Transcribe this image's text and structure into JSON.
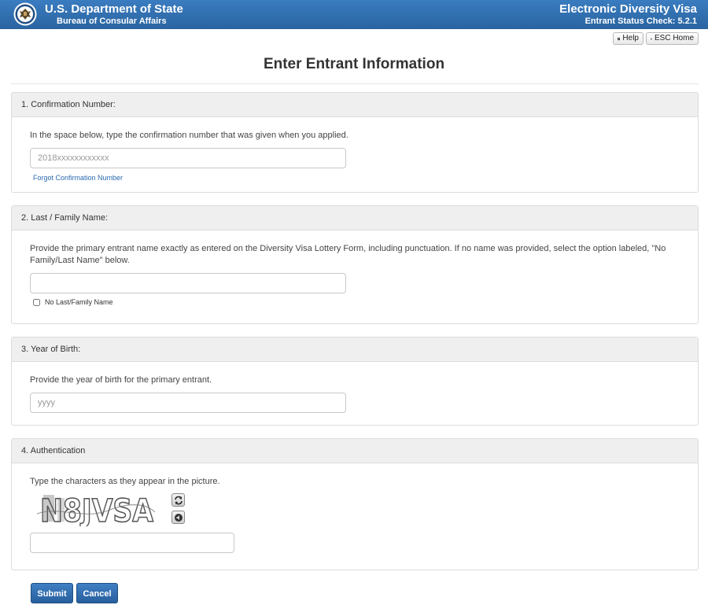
{
  "header": {
    "agency": "U.S. Department of State",
    "bureau": "Bureau of Consular Affairs",
    "app_title": "Electronic Diversity Visa",
    "app_subtitle": "Entrant Status Check: 5.2.1",
    "bg_color": "#2e6da4"
  },
  "toolbar": {
    "help_label": "Help",
    "help_icon": "question-circle-icon",
    "home_label": "ESC Home",
    "home_icon": "home-icon"
  },
  "page": {
    "title": "Enter Entrant Information"
  },
  "sections": {
    "confirmation": {
      "heading": "1. Confirmation Number:",
      "instruction": "In the space below, type the confirmation number that was given when you applied.",
      "placeholder": "2018xxxxxxxxxxxx",
      "value": "",
      "forgot_link": "Forgot Confirmation Number"
    },
    "last_name": {
      "heading": "2. Last / Family Name:",
      "instruction": "Provide the primary entrant name exactly as entered on the Diversity Visa Lottery Form, including punctuation. If no name was provided, select the option labeled, \"No Family/Last Name\" below.",
      "value": "",
      "checkbox_label": "No Last/Family Name",
      "checkbox_checked": false
    },
    "birth_year": {
      "heading": "3. Year of Birth:",
      "instruction": "Provide the year of birth for the primary entrant.",
      "placeholder": "yyyy",
      "value": ""
    },
    "authentication": {
      "heading": "4. Authentication",
      "instruction": "Type the characters as they appear in the picture.",
      "captcha_text": "N8JVSA",
      "refresh_icon": "refresh-icon",
      "audio_icon": "audio-icon",
      "value": ""
    }
  },
  "actions": {
    "submit_label": "Submit",
    "cancel_label": "Cancel"
  }
}
